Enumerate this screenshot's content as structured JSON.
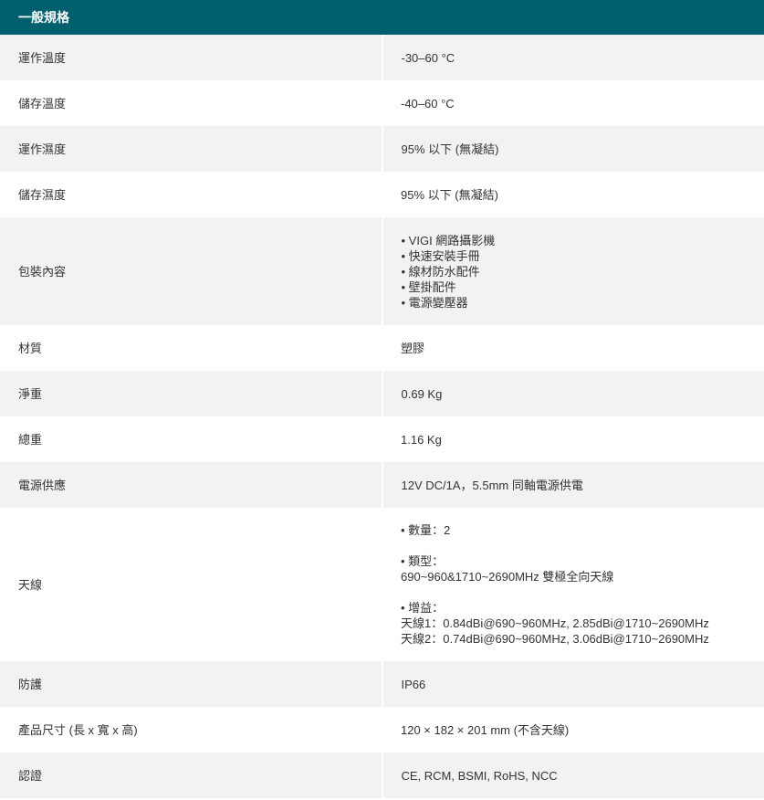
{
  "section": {
    "title": "一般規格"
  },
  "rows": [
    {
      "label": "運作溫度",
      "value": "-30–60 °C"
    },
    {
      "label": "儲存溫度",
      "value": "-40–60 °C"
    },
    {
      "label": "運作濕度",
      "value": "95% 以下 (無凝結)"
    },
    {
      "label": "儲存濕度",
      "value": "95% 以下 (無凝結)"
    },
    {
      "label": "包裝內容",
      "items": [
        "VIGI 網路攝影機",
        "快速安裝手冊",
        "線材防水配件",
        "壁掛配件",
        "電源變壓器"
      ]
    },
    {
      "label": "材質",
      "value": "塑膠"
    },
    {
      "label": "淨重",
      "value": "0.69 Kg"
    },
    {
      "label": "總重",
      "value": "1.16 Kg"
    },
    {
      "label": "電源供應",
      "value": "12V DC/1A，5.5mm 同軸電源供電"
    },
    {
      "label": "天線",
      "count": "• 數量：2",
      "type_label": "• 類型：",
      "type_value": "690~960&1710~2690MHz 雙極全向天線",
      "gain_label": "• 增益：",
      "gain_1": "天線1：0.84dBi@690~960MHz, 2.85dBi@1710~2690MHz",
      "gain_2": "天線2：0.74dBi@690~960MHz, 3.06dBi@1710~2690MHz"
    },
    {
      "label": "防護",
      "value": "IP66"
    },
    {
      "label": "產品尺寸 (長 x 寬 x 高)",
      "value": "120 × 182 × 201 mm (不含天線)"
    },
    {
      "label": "認證",
      "value": "CE, RCM, BSMI, RoHS, NCC"
    }
  ]
}
